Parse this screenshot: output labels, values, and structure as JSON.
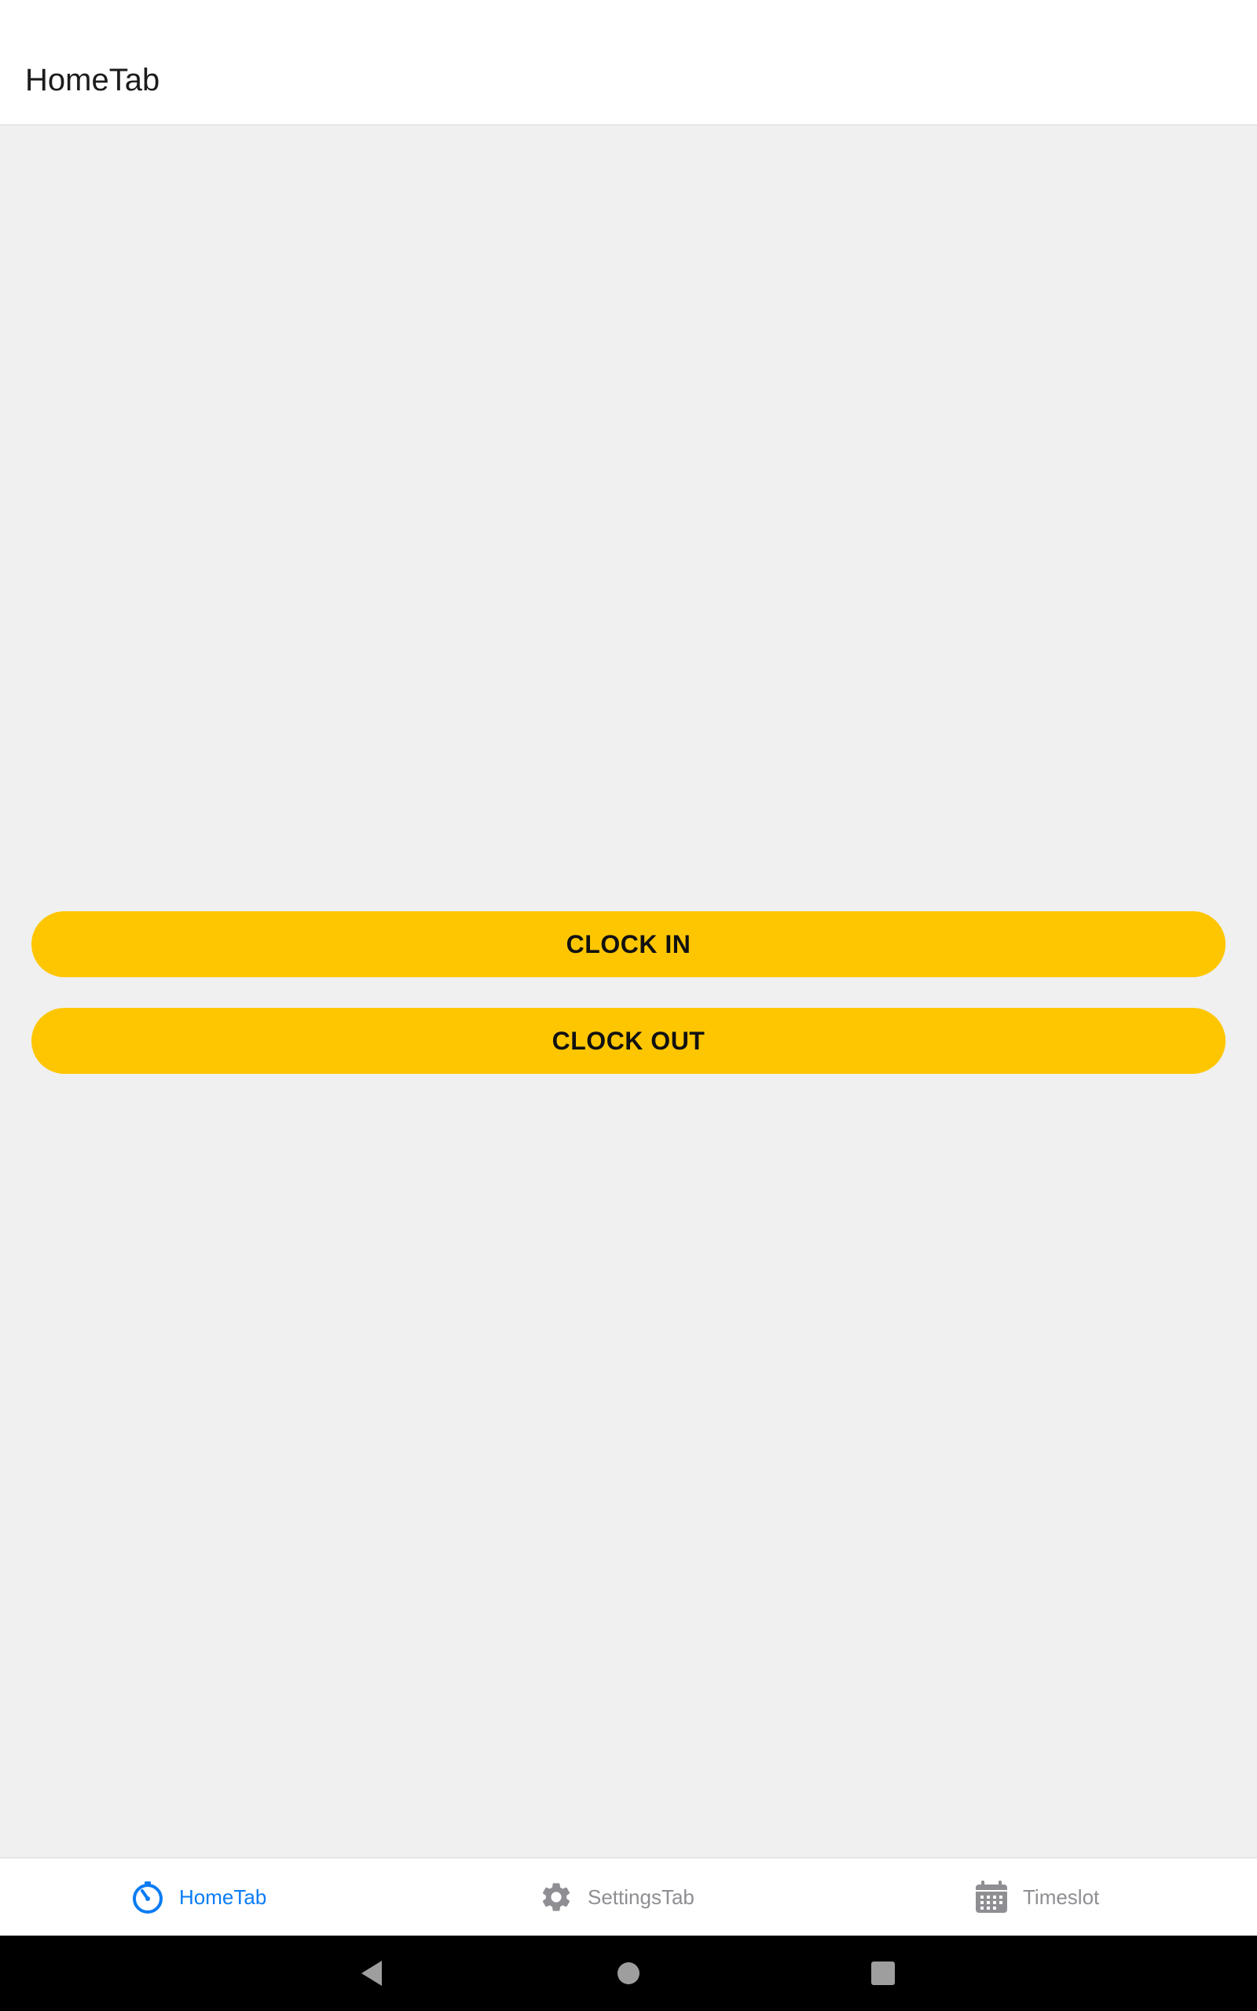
{
  "header": {
    "title": "HomeTab"
  },
  "main": {
    "clock_in_label": "CLOCK IN",
    "clock_out_label": "CLOCK OUT"
  },
  "tabbar": {
    "tabs": [
      {
        "label": "HomeTab",
        "icon": "stopwatch-icon",
        "active": true
      },
      {
        "label": "SettingsTab",
        "icon": "gear-icon",
        "active": false
      },
      {
        "label": "Timeslot",
        "icon": "calendar-icon",
        "active": false
      }
    ]
  },
  "navbar": {
    "buttons": [
      "back-icon",
      "home-icon",
      "recents-icon"
    ]
  },
  "colors": {
    "accent": "#0a7cf4",
    "button": "#fec600",
    "inactive": "#8e8e93",
    "background": "#f0f0f0"
  }
}
